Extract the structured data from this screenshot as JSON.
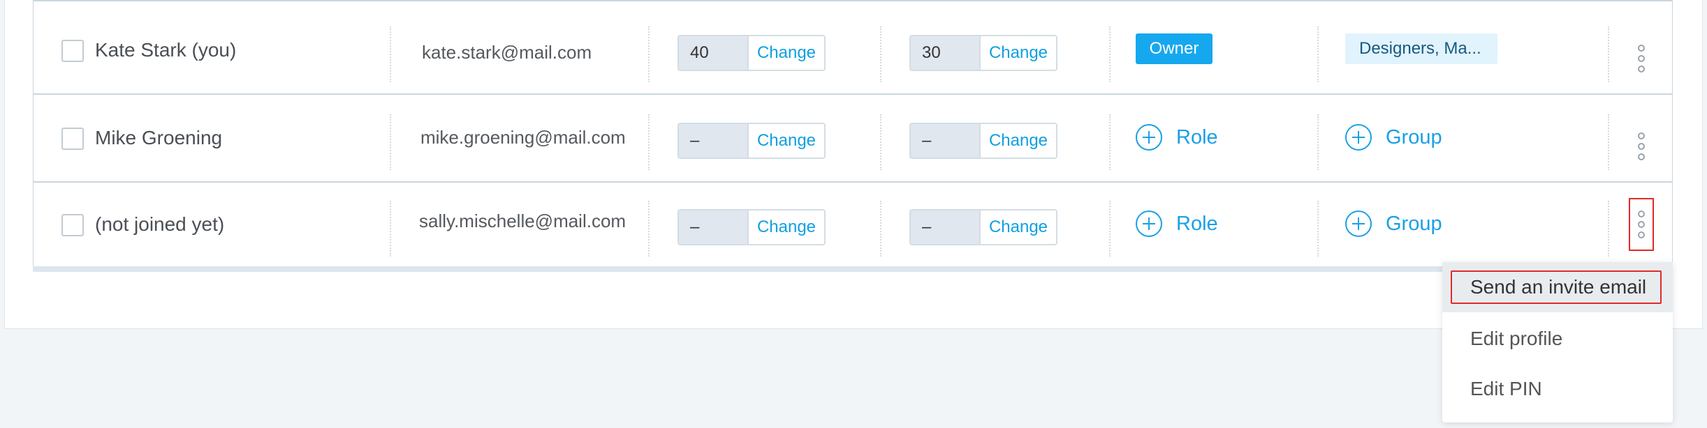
{
  "rows": [
    {
      "name": "Kate Stark (you)",
      "email": "kate.stark@mail.com",
      "stepper1": {
        "value": "40",
        "action": "Change"
      },
      "stepper2": {
        "value": "30",
        "action": "Change"
      },
      "role": "Owner",
      "group": "Designers, Ma..."
    },
    {
      "name": "Mike Groening",
      "email": "mike.groening@mail.com",
      "stepper1": {
        "value": "–",
        "action": "Change"
      },
      "stepper2": {
        "value": "–",
        "action": "Change"
      },
      "role_link": "Role",
      "group_link": "Group"
    },
    {
      "name": "(not joined yet)",
      "email": "sally.mischelle@mail.com",
      "stepper1": {
        "value": "–",
        "action": "Change"
      },
      "stepper2": {
        "value": "–",
        "action": "Change"
      },
      "role_link": "Role",
      "group_link": "Group"
    }
  ],
  "menu": {
    "items": [
      "Send an invite email",
      "Edit profile",
      "Edit PIN"
    ]
  },
  "icons": {
    "add": "plus-circle-icon",
    "more": "more-vertical-icon",
    "checkbox": "checkbox-unchecked"
  },
  "colors": {
    "accent": "#16a8ee",
    "link": "#1aa0e6",
    "highlight": "#e02a2a"
  }
}
